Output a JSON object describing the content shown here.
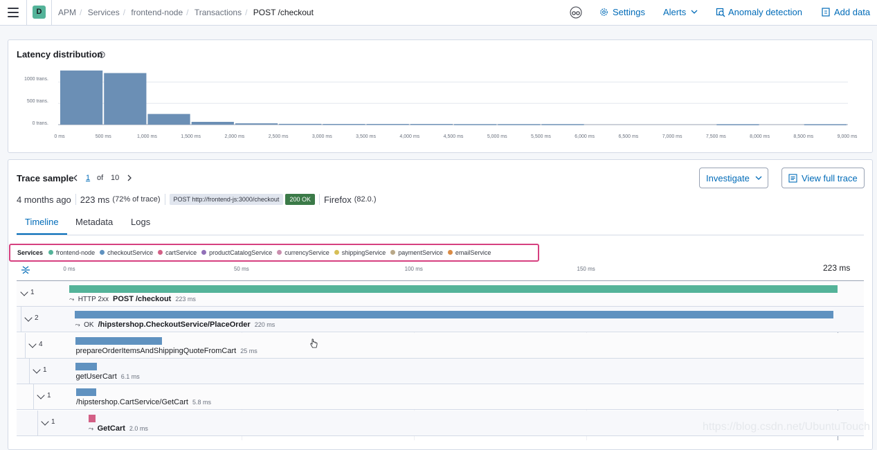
{
  "header": {
    "space_initial": "D",
    "breadcrumbs": [
      "APM",
      "Services",
      "frontend-node",
      "Transactions",
      "POST /checkout"
    ],
    "settings_label": "Settings",
    "alerts_label": "Alerts",
    "anomaly_label": "Anomaly detection",
    "add_data_label": "Add data"
  },
  "latency": {
    "title": "Latency distribution",
    "y_labels": [
      "1000 trans.",
      "500 trans.",
      "0 trans."
    ],
    "x_labels": [
      "0 ms",
      "500 ms",
      "1,000 ms",
      "1,500 ms",
      "2,000 ms",
      "2,500 ms",
      "3,000 ms",
      "3,500 ms",
      "4,000 ms",
      "4,500 ms",
      "5,000 ms",
      "5,500 ms",
      "6,000 ms",
      "6,500 ms",
      "7,000 ms",
      "7,500 ms",
      "8,000 ms",
      "8,500 ms",
      "9,000 ms"
    ]
  },
  "chart_data": {
    "type": "bar",
    "title": "Latency distribution",
    "xlabel": "",
    "ylabel": "",
    "bin_start_ms": [
      0,
      500,
      1000,
      1500,
      2000,
      2500,
      3000,
      3500,
      4000,
      4500,
      5000,
      5500,
      6000,
      6500,
      7000,
      7500,
      8000,
      8500
    ],
    "values": [
      1270,
      1210,
      250,
      65,
      30,
      18,
      15,
      15,
      15,
      12,
      12,
      12,
      0,
      0,
      0,
      10,
      0,
      10
    ],
    "ylim": [
      0,
      1300
    ],
    "xlim": [
      0,
      9000
    ],
    "grid": true
  },
  "trace": {
    "title": "Trace sample",
    "current": "1",
    "of_label": "of",
    "total": "10",
    "investigate_label": "Investigate",
    "view_full_trace_label": "View full trace",
    "age": "4 months ago",
    "duration": "223 ms",
    "duration_pct": "(72% of trace)",
    "url_badge": "POST http://frontend-js:3000/checkout",
    "status_badge": "200 OK",
    "browser": "Firefox",
    "browser_version": "(82.0.)",
    "status_color": "#3b7a48"
  },
  "tabs": [
    "Timeline",
    "Metadata",
    "Logs"
  ],
  "legend": {
    "title": "Services",
    "items": [
      {
        "name": "frontend-node",
        "color": "#54b399"
      },
      {
        "name": "checkoutService",
        "color": "#6092c0"
      },
      {
        "name": "cartService",
        "color": "#d36086"
      },
      {
        "name": "productCatalogService",
        "color": "#9170b8"
      },
      {
        "name": "currencyService",
        "color": "#ca8eae"
      },
      {
        "name": "shippingService",
        "color": "#d6bf57"
      },
      {
        "name": "paymentService",
        "color": "#b9a888"
      },
      {
        "name": "emailService",
        "color": "#da8b45"
      }
    ]
  },
  "timeline": {
    "ticks": [
      "0 ms",
      "50 ms",
      "100 ms",
      "150 ms"
    ],
    "total": "223 ms",
    "total_ms": 223,
    "rows": [
      {
        "count": "1",
        "prefix": "HTTP 2xx",
        "name": "POST /checkout",
        "duration": "223 ms",
        "start_ms": 0,
        "dur_ms": 223,
        "color": "#54b399",
        "bold": true
      },
      {
        "count": "2",
        "prefix": "OK",
        "name": "/hipstershop.CheckoutService/PlaceOrder",
        "duration": "220 ms",
        "start_ms": 1.7,
        "dur_ms": 220,
        "color": "#6092c0",
        "bold": true
      },
      {
        "count": "4",
        "prefix": "",
        "name": "prepareOrderItemsAndShippingQuoteFromCart",
        "duration": "25 ms",
        "start_ms": 1.9,
        "dur_ms": 25,
        "color": "#6092c0",
        "bold": false
      },
      {
        "count": "1",
        "prefix": "",
        "name": "getUserCart",
        "duration": "6.1 ms",
        "start_ms": 1.9,
        "dur_ms": 6.1,
        "color": "#6092c0",
        "bold": false
      },
      {
        "count": "1",
        "prefix": "",
        "name": "/hipstershop.CartService/GetCart",
        "duration": "5.8 ms",
        "start_ms": 2.0,
        "dur_ms": 5.8,
        "color": "#6092c0",
        "bold": false
      },
      {
        "count": "1",
        "prefix": "",
        "name": "GetCart",
        "duration": "2.0 ms",
        "start_ms": 5.6,
        "dur_ms": 2.0,
        "color": "#d36086",
        "bold": true
      }
    ]
  },
  "watermark": "https://blog.csdn.net/UbuntuTouch"
}
